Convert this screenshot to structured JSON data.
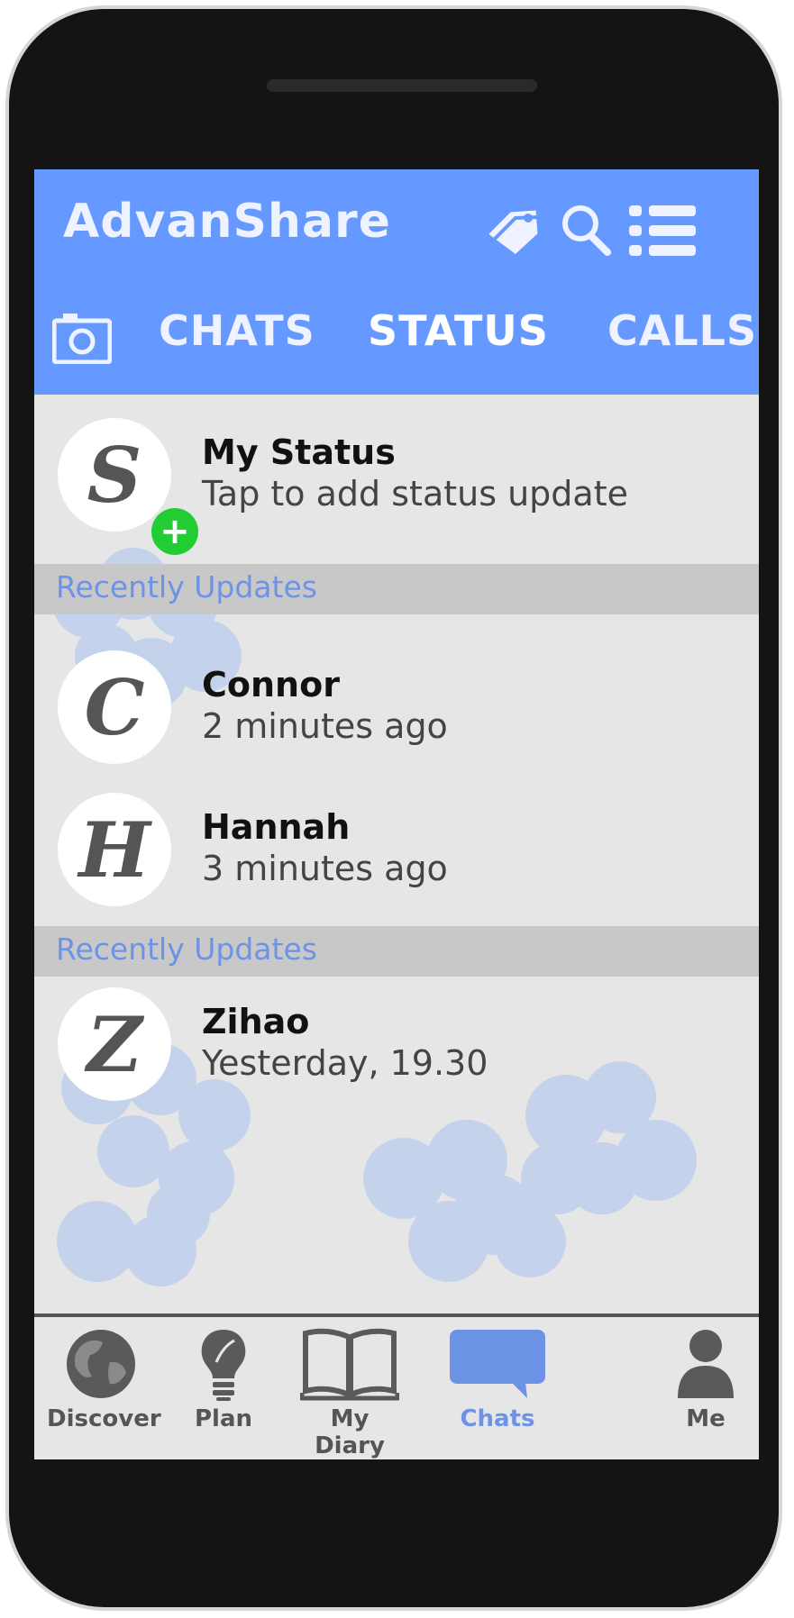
{
  "app": {
    "title": "AdvanShare"
  },
  "header_icons": [
    "tag-icon",
    "search-icon",
    "menu-list-icon"
  ],
  "tabs": {
    "camera_icon": "camera-icon",
    "items": [
      {
        "label": "CHATS",
        "active": false
      },
      {
        "label": "STATUS",
        "active": true
      },
      {
        "label": "CALLS",
        "active": false
      }
    ]
  },
  "my_status": {
    "initial": "S",
    "title": "My Status",
    "subtitle": "Tap to add status update",
    "add_symbol": "+"
  },
  "sections": [
    {
      "header": "Recently Updates",
      "items": [
        {
          "initial": "C",
          "name": "Connor",
          "time": "2 minutes ago"
        },
        {
          "initial": "H",
          "name": "Hannah",
          "time": "3 minutes ago"
        }
      ]
    },
    {
      "header": "Recently Updates",
      "items": [
        {
          "initial": "Z",
          "name": "Zihao",
          "time": "Yesterday, 19.30"
        }
      ]
    }
  ],
  "bottom_nav": [
    {
      "label": "Discover",
      "icon": "globe-icon",
      "active": false
    },
    {
      "label": "Plan",
      "icon": "lightbulb-icon",
      "active": false
    },
    {
      "label": "My Diary",
      "icon": "book-icon",
      "active": false
    },
    {
      "label": "Chats",
      "icon": "chat-bubble-icon",
      "active": true
    },
    {
      "label": "Me",
      "icon": "person-icon",
      "active": false
    }
  ],
  "colors": {
    "appbar": "#6699ff",
    "accent": "#6d93e6",
    "add_green": "#22cc33",
    "section_bg": "#c8c8c8",
    "content_bg": "#e6e6e6"
  }
}
